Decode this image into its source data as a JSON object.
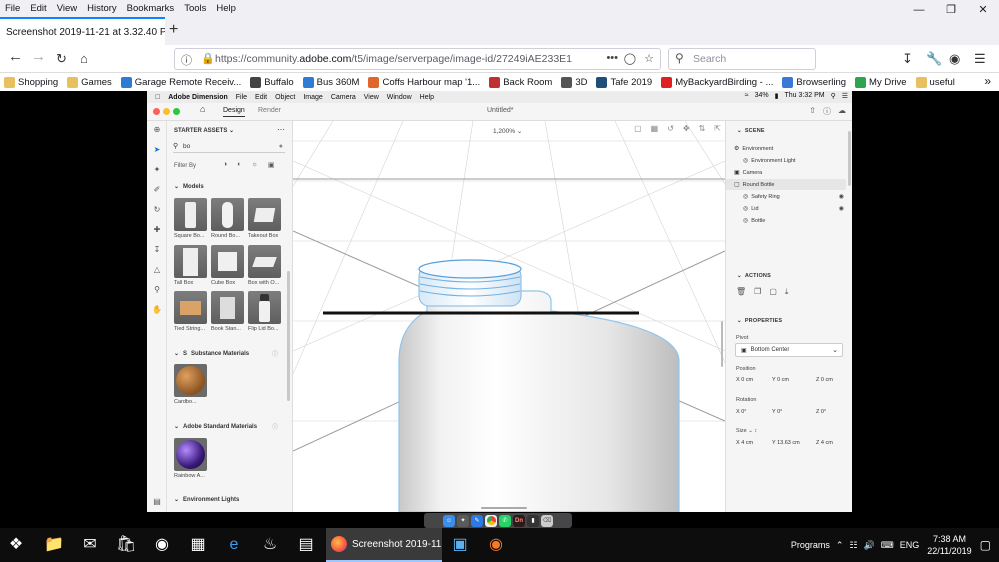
{
  "browser": {
    "menu": [
      "File",
      "Edit",
      "View",
      "History",
      "Bookmarks",
      "Tools",
      "Help"
    ],
    "tab_title": "Screenshot 2019-11-21 at 3.32.40 PM",
    "url_prefix": "https://community.",
    "url_host": "adobe.com",
    "url_rest": "/t5/image/serverpage/image-id/27249iAE233E1",
    "search_placeholder": "Search",
    "bookmarks": [
      {
        "label": "Shopping",
        "color": "#e8c060"
      },
      {
        "label": "Games",
        "color": "#e8c060"
      },
      {
        "label": "Garage Remote Receiv...",
        "color": "#2e7bd6"
      },
      {
        "label": "Buffalo",
        "color": "#444444"
      },
      {
        "label": "Bus 360M",
        "color": "#2e7bd6"
      },
      {
        "label": "Coffs Harbour map '1...",
        "color": "#e0662c"
      },
      {
        "label": "Back Room",
        "color": "#c03030"
      },
      {
        "label": "3D",
        "color": "#555555"
      },
      {
        "label": "Tafe 2019",
        "color": "#1f4e79"
      },
      {
        "label": "MyBackyardBirding - ...",
        "color": "#e02020"
      },
      {
        "label": "Browserling",
        "color": "#3a78d8"
      },
      {
        "label": "My Drive",
        "color": "#2ea44f"
      },
      {
        "label": "useful",
        "color": "#e8c060"
      }
    ]
  },
  "mac_menu": {
    "app": "Adobe Dimension",
    "items": [
      "File",
      "Edit",
      "Object",
      "Image",
      "Camera",
      "View",
      "Window",
      "Help"
    ],
    "battery": "34%",
    "clock": "Thu 3:32 PM"
  },
  "dimension": {
    "tabs": [
      "Design",
      "Render"
    ],
    "document_title": "Untitled*",
    "zoom": "1,200%",
    "assets": {
      "header": "STARTER ASSETS",
      "search_value": "bo",
      "filter_label": "Filter By",
      "models_title": "Models",
      "models": [
        "Square Bo...",
        "Round Bo...",
        "Takeout Box",
        "Tall Box",
        "Cube Box",
        "Box with O...",
        "Tied String...",
        "Book Stan...",
        "Flip Lid Bo..."
      ],
      "substance_title": "Substance Materials",
      "substance_items": [
        "Cardbo..."
      ],
      "standard_title": "Adobe Standard Materials",
      "standard_items": [
        "Rainbow A..."
      ],
      "env_title": "Environment Lights"
    },
    "scene": {
      "title": "SCENE",
      "items": [
        {
          "label": "Environment",
          "indent": 0
        },
        {
          "label": "Environment Light",
          "indent": 1
        },
        {
          "label": "Camera",
          "indent": 0
        },
        {
          "label": "Round Bottle",
          "indent": 0
        },
        {
          "label": "Safety Ring",
          "indent": 1
        },
        {
          "label": "Lid",
          "indent": 1
        },
        {
          "label": "Bottle",
          "indent": 1
        }
      ]
    },
    "actions_title": "ACTIONS",
    "properties": {
      "title": "PROPERTIES",
      "pivot_label": "Pivot",
      "pivot_value": "Bottom Center",
      "position_label": "Position",
      "position": {
        "x": "X  0 cm",
        "y": "Y  0 cm",
        "z": "Z  0 cm"
      },
      "rotation_label": "Rotation",
      "rotation": {
        "x": "X  0°",
        "y": "Y  0°",
        "z": "Z  0°"
      },
      "size_label": "Size",
      "size": {
        "x": "X  4 cm",
        "y": "Y  13.63 cm",
        "z": "Z  4 cm"
      }
    }
  },
  "taskbar": {
    "active_window": "Screenshot 2019-11...",
    "programs_label": "Programs",
    "language": "ENG",
    "time": "7:38 AM",
    "date": "22/11/2019"
  }
}
